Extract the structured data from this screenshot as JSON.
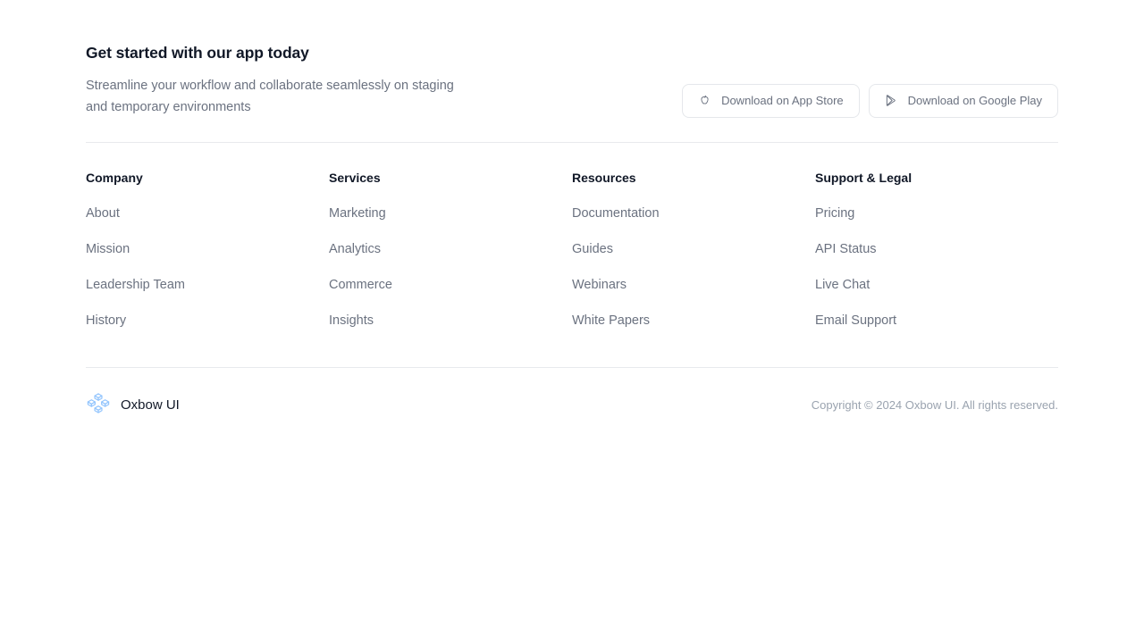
{
  "cta": {
    "heading": "Get started with our app today",
    "subtext": "Streamline your workflow and collaborate seamlessly on staging and temporary environments",
    "buttons": [
      {
        "label": "Download on App Store",
        "icon": "apple-icon"
      },
      {
        "label": "Download on Google Play",
        "icon": "google-play-icon"
      }
    ]
  },
  "columns": [
    {
      "title": "Company",
      "links": [
        "About",
        "Mission",
        "Leadership Team",
        "History"
      ]
    },
    {
      "title": "Services",
      "links": [
        "Marketing",
        "Analytics",
        "Commerce",
        "Insights"
      ]
    },
    {
      "title": "Resources",
      "links": [
        "Documentation",
        "Guides",
        "Webinars",
        "White Papers"
      ]
    },
    {
      "title": "Support & Legal",
      "links": [
        "Pricing",
        "API Status",
        "Live Chat",
        "Email Support"
      ]
    }
  ],
  "bottom": {
    "logo_icon": "oxbow-cubes-logo-icon",
    "brand_name": "Oxbow UI",
    "copyright": "Copyright © 2024 Oxbow UI. All rights reserved."
  },
  "colors": {
    "heading": "#111827",
    "muted_text": "#6b7280",
    "copyright_text": "#9aa3af",
    "divider": "#e8eaed",
    "button_border": "#e5e7eb",
    "logo_blue": "#93c5fd",
    "background": "#ffffff"
  }
}
